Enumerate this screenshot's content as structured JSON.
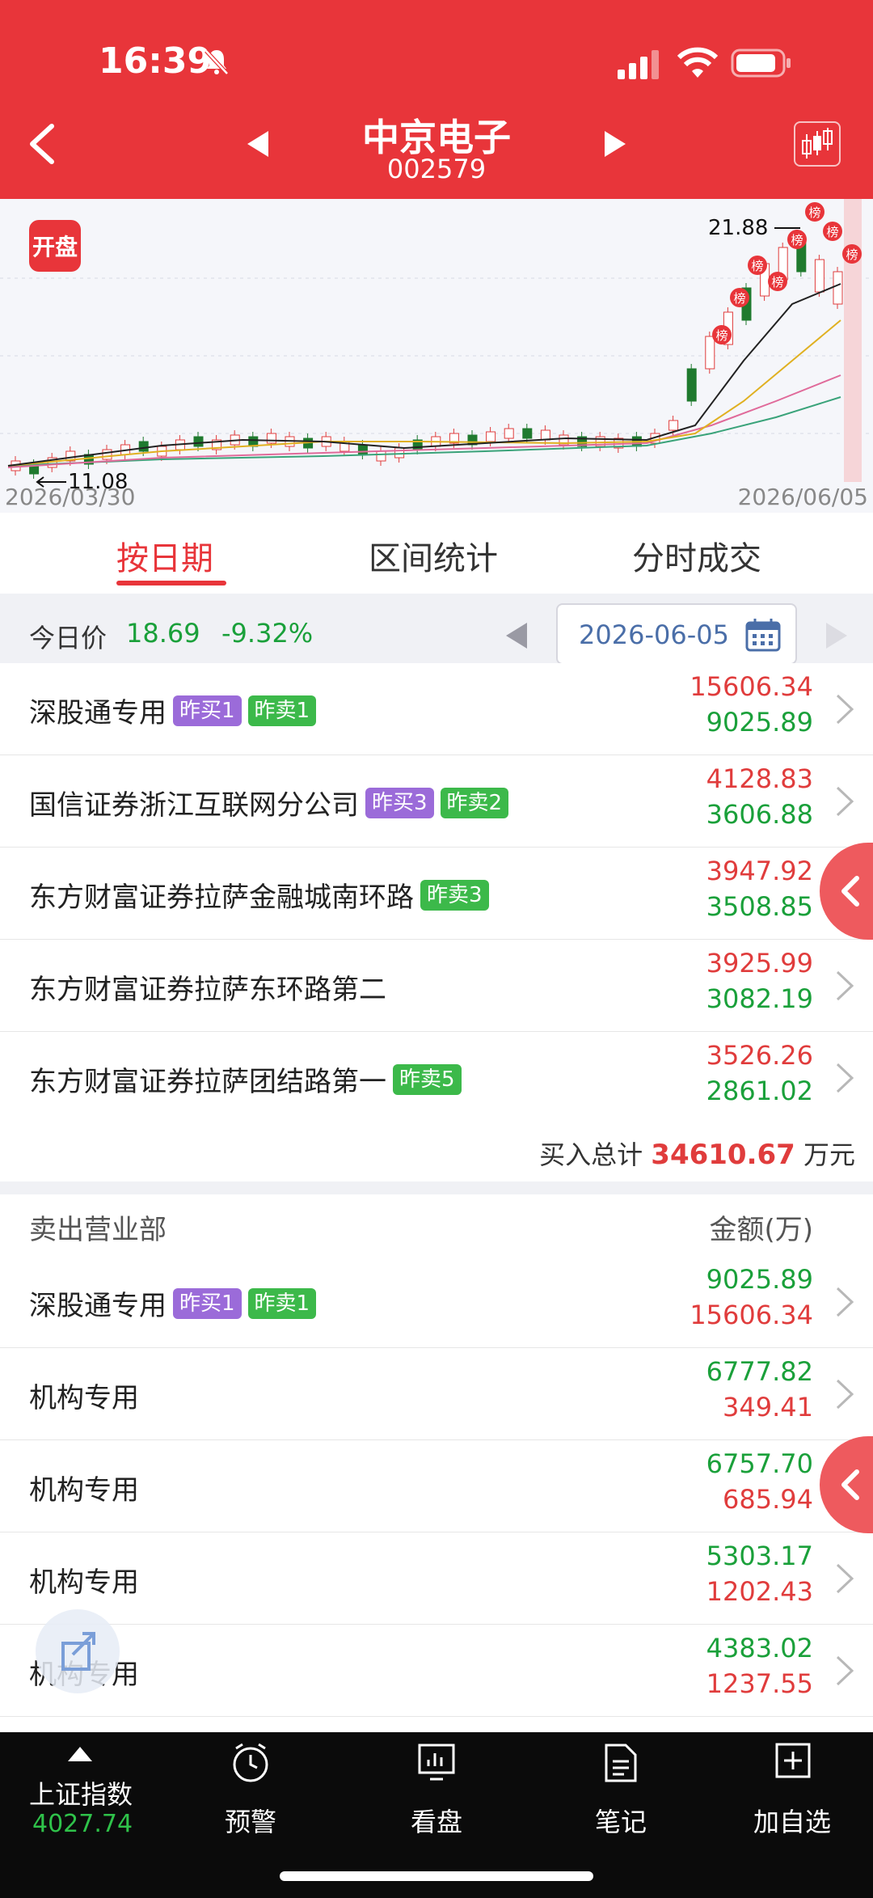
{
  "status_bar": {
    "time": "16:39"
  },
  "header": {
    "stock_name": "中京电子",
    "stock_code": "002579"
  },
  "chart": {
    "badge": "开盘",
    "high_label": "21.88",
    "low_label": "11.08",
    "date_start": "2026/03/30",
    "date_end": "2026/06/05",
    "marker_label": "榜"
  },
  "tabs": [
    {
      "label": "按日期",
      "active": true
    },
    {
      "label": "区间统计",
      "active": false
    },
    {
      "label": "分时成交",
      "active": false
    }
  ],
  "price_bar": {
    "label": "今日价",
    "price": "18.69",
    "change": "-9.32%",
    "date": "2026-06-05"
  },
  "buy_rows": [
    {
      "name": "深股通专用",
      "tags": [
        {
          "text": "昨买1",
          "kind": "buy"
        },
        {
          "text": "昨卖1",
          "kind": "sell"
        }
      ],
      "v1": "15606.34",
      "v2": "9025.89"
    },
    {
      "name": "国信证券浙江互联网分公司",
      "tags": [
        {
          "text": "昨买3",
          "kind": "buy"
        },
        {
          "text": "昨卖2",
          "kind": "sell"
        }
      ],
      "v1": "4128.83",
      "v2": "3606.88"
    },
    {
      "name": "东方财富证券拉萨金融城南环路",
      "tags": [
        {
          "text": "昨卖3",
          "kind": "sell"
        }
      ],
      "v1": "3947.92",
      "v2": "3508.85"
    },
    {
      "name": "东方财富证券拉萨东环路第二",
      "tags": [],
      "v1": "3925.99",
      "v2": "3082.19"
    },
    {
      "name": "东方财富证券拉萨团结路第一",
      "tags": [
        {
          "text": "昨卖5",
          "kind": "sell"
        }
      ],
      "v1": "3526.26",
      "v2": "2861.02"
    }
  ],
  "buy_total": {
    "label": "买入总计",
    "value": "34610.67",
    "unit": "万元"
  },
  "sell_section": {
    "title": "卖出营业部",
    "amount_header": "金额(万)"
  },
  "sell_rows": [
    {
      "name": "深股通专用",
      "tags": [
        {
          "text": "昨买1",
          "kind": "buy"
        },
        {
          "text": "昨卖1",
          "kind": "sell"
        }
      ],
      "v1": "9025.89",
      "v2": "15606.34"
    },
    {
      "name": "机构专用",
      "tags": [],
      "v1": "6777.82",
      "v2": "349.41"
    },
    {
      "name": "机构专用",
      "tags": [],
      "v1": "6757.70",
      "v2": "685.94"
    },
    {
      "name": "机构专用",
      "tags": [],
      "v1": "5303.17",
      "v2": "1202.43"
    },
    {
      "name": "机构专用",
      "tags": [],
      "v1": "4383.02",
      "v2": "1237.55"
    }
  ],
  "bottom_nav": {
    "index_name": "上证指数",
    "index_value": "4027.74",
    "items": [
      "预警",
      "看盘",
      "笔记",
      "加自选"
    ]
  }
}
